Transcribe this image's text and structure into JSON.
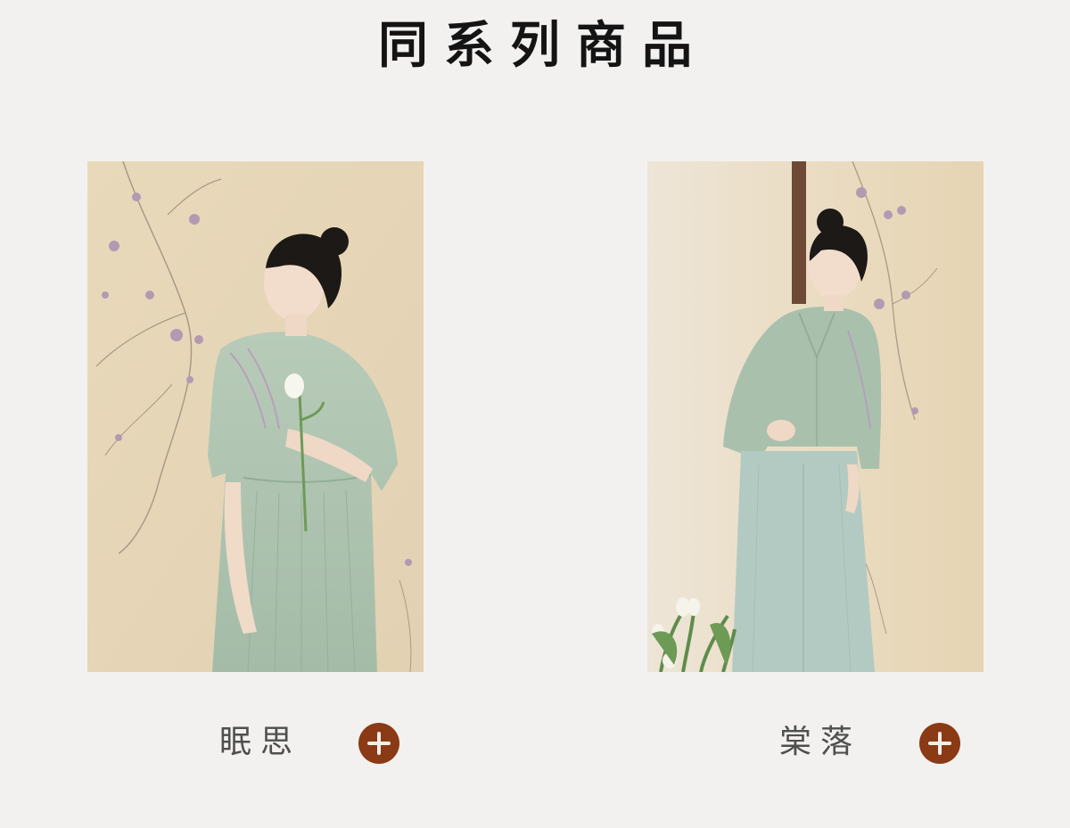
{
  "section": {
    "title": "同系列商品"
  },
  "products": [
    {
      "name": "眠思",
      "image_icon": "model-green-embroidered-dress-image",
      "add_icon": "plus-circle-icon"
    },
    {
      "name": "棠落",
      "image_icon": "model-green-shirt-and-pants-image",
      "add_icon": "plus-circle-icon"
    }
  ],
  "colors": {
    "background": "#f2f1ef",
    "title": "#141414",
    "label": "#4f4f4f",
    "add_button": "#8a3a14",
    "wall": "#e6d6b8",
    "garment": "#aec5b1"
  }
}
